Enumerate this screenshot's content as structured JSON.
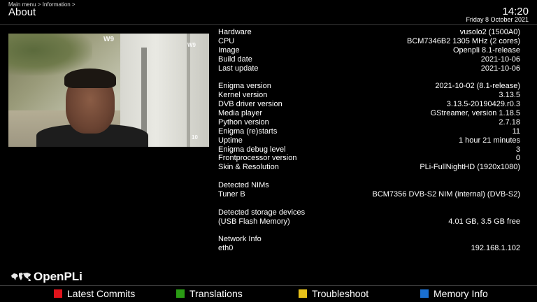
{
  "header": {
    "breadcrumb": "Main menu > Information >",
    "title": "About",
    "time": "14:20",
    "date": "Friday  8 October 2021"
  },
  "pip": {
    "watermark_top": "W9",
    "watermark_right": "W9",
    "watermark_bottom": "10"
  },
  "info": {
    "system": [
      {
        "label": "Hardware",
        "value": "vusolo2 (1500A0)"
      },
      {
        "label": "CPU",
        "value": "BCM7346B2 1305 MHz (2 cores)"
      },
      {
        "label": "Image",
        "value": "Openpli 8.1-release"
      },
      {
        "label": "Build date",
        "value": "2021-10-06"
      },
      {
        "label": "Last update",
        "value": "2021-10-06"
      }
    ],
    "software": [
      {
        "label": "Enigma version",
        "value": "2021-10-02 (8.1-release)"
      },
      {
        "label": "Kernel version",
        "value": "3.13.5"
      },
      {
        "label": "DVB driver version",
        "value": "3.13.5-20190429.r0.3"
      },
      {
        "label": "Media player",
        "value": "GStreamer, version 1.18.5"
      },
      {
        "label": "Python version",
        "value": "2.7.18"
      },
      {
        "label": "Enigma (re)starts",
        "value": "11"
      },
      {
        "label": "Uptime",
        "value": "1 hour 21 minutes"
      },
      {
        "label": "Enigma debug level",
        "value": "3"
      },
      {
        "label": "Frontprocessor version",
        "value": "0"
      },
      {
        "label": "Skin & Resolution",
        "value": "PLi-FullNightHD (1920x1080)"
      }
    ],
    "nims_heading": "Detected NIMs",
    "nims": [
      {
        "label": "Tuner B",
        "value": "BCM7356 DVB-S2 NIM (internal) (DVB-S2)"
      }
    ],
    "storage_heading": "Detected storage devices",
    "storage": [
      {
        "label": " (USB Flash Memory)",
        "value": "4.01 GB, 3.5 GB free"
      }
    ],
    "network_heading": "Network Info",
    "network": [
      {
        "label": "eth0",
        "value": "192.168.1.102"
      }
    ]
  },
  "logo": {
    "text": "OpenPLi"
  },
  "keys": {
    "red": {
      "label": "Latest Commits",
      "color": "#e0131b"
    },
    "green": {
      "label": "Translations",
      "color": "#2a9c14"
    },
    "yellow": {
      "label": "Troubleshoot",
      "color": "#e8c21a"
    },
    "blue": {
      "label": "Memory Info",
      "color": "#1a6fd0"
    }
  }
}
